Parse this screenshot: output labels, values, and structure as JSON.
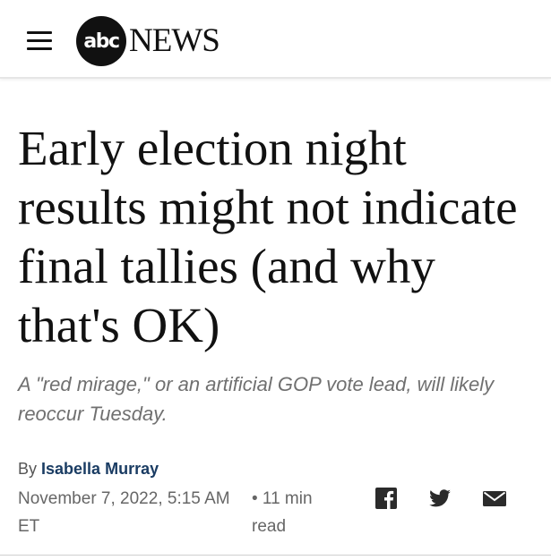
{
  "header": {
    "logo": {
      "mark": "abc",
      "wordmark": "NEWS"
    },
    "menu_icon": "hamburger-menu-icon"
  },
  "article": {
    "headline": "Early election night results might not indicate final tallies (and why that's OK)",
    "subheadline": "A \"red mirage,\" or an artificial GOP vote lead, will likely reoccur Tuesday.",
    "byline_prefix": "By",
    "author": "Isabella Murray",
    "date": "November 7, 2022, 5:15 AM ET",
    "read_time": "• 11 min read"
  },
  "share": {
    "icons": [
      "facebook-icon",
      "twitter-icon",
      "email-icon"
    ]
  },
  "colors": {
    "text": "#111111",
    "subhead": "#707070",
    "meta": "#666666",
    "author": "#1a3c63",
    "share_icon": "#2b2b2b"
  }
}
